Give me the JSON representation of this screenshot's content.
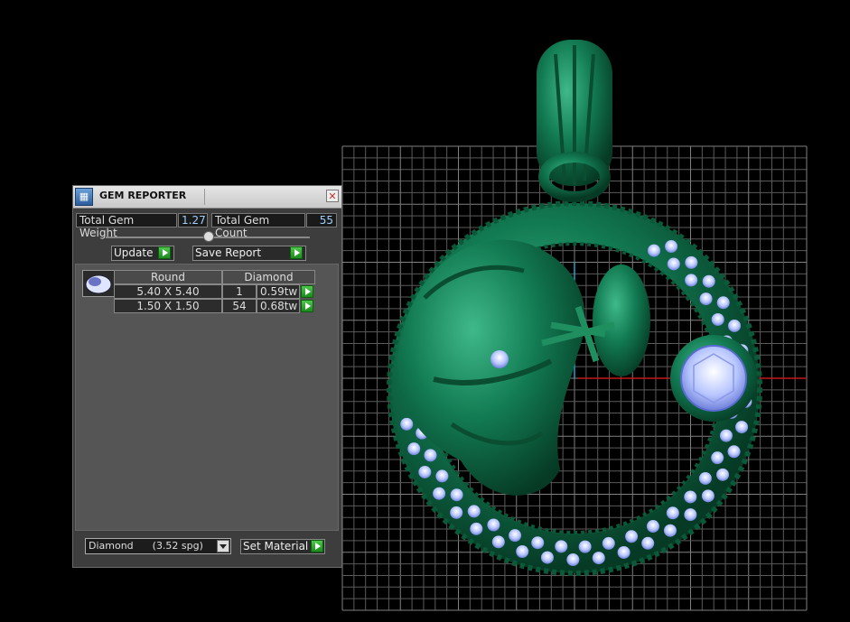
{
  "panel": {
    "title": "GEM REPORTER",
    "close_glyph": "✕",
    "total_weight_label": "Total Gem Weight",
    "total_weight_value": "1.27",
    "total_count_label": "Total Gem Count",
    "total_count_value": "55",
    "update_label": "Update",
    "save_report_label": "Save Report",
    "gem_table": {
      "shape": "Round",
      "material": "Diamond",
      "rows": [
        {
          "size": "5.40 X 5.40",
          "count": "1",
          "weight": "0.59tw"
        },
        {
          "size": "1.50 X 1.50",
          "count": "54",
          "weight": "0.68tw"
        }
      ]
    },
    "material_select": "Diamond      (3.52 spg)",
    "set_material_label": "Set Material"
  },
  "icons": {
    "app": "gem-reporter-app-icon",
    "close": "close-icon",
    "arrow": "play-arrow-icon",
    "thumb": "gem-oval-icon"
  },
  "colors": {
    "model": "#0f6b45",
    "gem": "#c8d4ff",
    "grid": "#5a5a5a",
    "accent_button": "#2ea82e"
  }
}
